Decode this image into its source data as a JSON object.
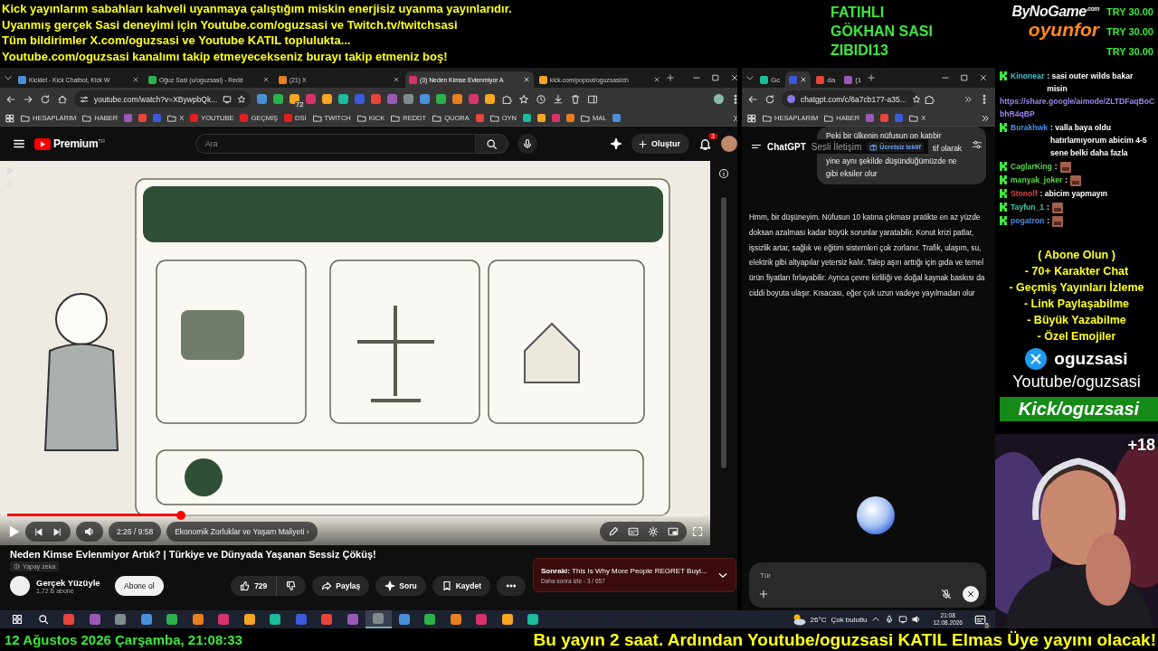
{
  "overlay": {
    "notices": [
      "Kick yayınlarım sabahları kahveli uyanmaya çalıştığım miskin enerjisiz uyanma yayınlarıdır.",
      "Uyanmış gerçek Sasi deneyimi için Youtube.com/oguzsasi ve Twitch.tv/twitchsasi",
      "Tüm bildirimler X.com/oguzsasi ve Youtube KATIL toplulukta...",
      "Youtube.com/oguzsasi kanalımı takip etmeyecekseniz burayı takip etmeniz boş!"
    ],
    "sponsors": [
      "FATIHLI",
      "GÖKHAN SASI",
      "ZIBIDI13"
    ],
    "logo": {
      "name": "ByNoGame",
      "suffix": ".com",
      "sub": "oyunfor"
    },
    "donations": [
      "TRY 30.00",
      "TRY 30.00",
      "TRY 30.00"
    ]
  },
  "left_browser": {
    "tabs": [
      {
        "title": "Kicklet - Kick Chatbot, Kick W",
        "selected": false
      },
      {
        "title": "Oğuz Sasi (u/oguzsasi) - Redd",
        "selected": false
      },
      {
        "title": "(21) X",
        "selected": false
      },
      {
        "title": "(3) Neden Kimse Evlenmiyor A",
        "selected": true
      },
      {
        "title": "kick.com/popout/oguzsasi/ch",
        "selected": false
      }
    ],
    "url": "youtube.com/watch?v=XBywpbQk...",
    "extension_badge": "72",
    "bookmarks": [
      {
        "kind": "folder",
        "label": "HESAPLARIM"
      },
      {
        "kind": "folder",
        "label": "HABER"
      },
      {
        "kind": "site"
      },
      {
        "kind": "site"
      },
      {
        "kind": "site"
      },
      {
        "kind": "folder",
        "label": "X"
      },
      {
        "kind": "video",
        "label": "YOUTUBE"
      },
      {
        "kind": "video",
        "label": "GEÇMİŞ"
      },
      {
        "kind": "video",
        "label": "DSİ"
      },
      {
        "kind": "folder",
        "label": "TWITCH"
      },
      {
        "kind": "folder",
        "label": "KICK"
      },
      {
        "kind": "folder",
        "label": "REDDT"
      },
      {
        "kind": "folder",
        "label": "QUORA"
      },
      {
        "kind": "site"
      },
      {
        "kind": "folder",
        "label": "OYN"
      },
      {
        "kind": "site"
      },
      {
        "kind": "site"
      },
      {
        "kind": "site"
      },
      {
        "kind": "site"
      },
      {
        "kind": "folder",
        "label": "MAL"
      },
      {
        "kind": "site"
      }
    ]
  },
  "youtube": {
    "logo": "Premium",
    "region": "TR",
    "search_placeholder": "Ara",
    "create": "Oluştur",
    "notifications": "3",
    "player": {
      "level": 0.25,
      "time": "2:26 / 9:58",
      "chapter": "Ekonomik Zorluklar ve Yaşam Maliyeti ›"
    },
    "title": "Neden Kimse Evlenmiyor Artık? | Türkiye ve Dünyada Yaşanan Sessiz Çöküş!",
    "ai_badge": "Yapay zeka",
    "channel": "Gerçek Yüzüyle",
    "subscribers": "1,72 B abone",
    "subscribe": "Abone ol",
    "likes": "729",
    "share": "Paylaş",
    "ask": "Soru",
    "save": "Kaydet",
    "up_next": {
      "title": "**Sonraki:** This Is Why More People REGRET Buyi...",
      "meta": "Daha sonra izle - 3 / 657"
    }
  },
  "right_browser": {
    "tabs": [
      {
        "title": "Gc",
        "selected": false
      },
      {
        "selected": true
      },
      {
        "title": "da",
        "selected": false
      },
      {
        "title": "(1",
        "selected": false
      }
    ],
    "url": "chatgpt.com/c/6a7cb177-a35...",
    "bookmarks": [
      {
        "kind": "folder",
        "label": "HESAPLARIM"
      },
      {
        "kind": "folder",
        "label": "HABER"
      },
      {
        "kind": "site"
      },
      {
        "kind": "site"
      },
      {
        "kind": "site"
      },
      {
        "kind": "folder",
        "label": "X"
      }
    ]
  },
  "chatgpt": {
    "brand": "ChatGPT",
    "mode": "Sesli İletişim",
    "offer": "Ücretsiz teklif",
    "user_message": [
      "Peki bir ülkenin nüfusun on katıbir",
      "tif olarak",
      "yine aynı şekilde düşündüğümüzde ne",
      "gibi eksiler olur"
    ],
    "reply": "Hmm, bir düşüneyim. Nüfusun 10 katına çıkması pratikte en az yüzde doksan azalması kadar büyük sorunlar yaratabilir. Konut krizi patlar, işsizlik artar, sağlık ve eğitim sistemleri çok zorlanır. Trafik, ulaşım, su, elektrik gibi altyapılar yetersiz kalır. Talep aşırı arttığı için gıda ve temel ürün fiyatları fırlayabilir. Ayrıca çevre kirliliği ve doğal kaynak baskısı da ciddi boyuta ulaşır. Kısacası, eğer çok uzun vadeye yayılmadan olur",
    "input_placeholder": "Tür"
  },
  "taskbar": {
    "apps": [
      {
        "selected": false
      },
      {
        "selected": false
      },
      {
        "selected": false
      },
      {
        "selected": false
      },
      {
        "selected": false
      },
      {
        "selected": false
      },
      {
        "selected": false
      },
      {
        "selected": false
      },
      {
        "selected": false
      },
      {
        "selected": false
      },
      {
        "selected": false
      },
      {
        "selected": false
      },
      {
        "selected": true
      },
      {
        "selected": false
      },
      {
        "selected": false
      },
      {
        "selected": false
      },
      {
        "selected": false
      },
      {
        "selected": false
      },
      {
        "selected": false
      }
    ],
    "weather": {
      "temp": "26°C",
      "desc": "Çok bulutlu"
    },
    "time": "21:08",
    "date": "12.08.2026",
    "notifications": "5"
  },
  "side_chat": {
    "messages": [
      {
        "user": "Kinonear",
        "color": "#3ec8d8",
        "message": ": sasi outer wilds bakar misin",
        "link": "https://share.google/aimode/ZLTDFaqBoCbhR4qBP",
        "emote": false
      },
      {
        "user": "Burakhwk",
        "color": "#4a8ee8",
        "message": ": valla baya oldu hatırlamıyorum abicim 4-5 sene belki daha fazla",
        "emote": false
      },
      {
        "user": "CaglarKing",
        "color": "#5ad84a",
        "message": ":",
        "emote": true
      },
      {
        "user": "manyak_joker",
        "color": "#5ad84a",
        "message": ":",
        "emote": true
      },
      {
        "user": "Stonolf",
        "color": "#e04040",
        "message": ": abicim yapmayın",
        "emote": false
      },
      {
        "user": "Tayfun_1",
        "color": "#3ec8a8",
        "message": ":",
        "emote": true
      },
      {
        "user": "pogatron",
        "color": "#4a8ee8",
        "message": ":",
        "emote": true
      }
    ]
  },
  "promo": {
    "heading": "( Abone Olun )",
    "perks": [
      "- 70+ Karakter Chat",
      "- Geçmiş Yayınları İzleme",
      "- Link Paylaşabilme",
      "- Büyük Yazabilme",
      "- Özel Emojiler"
    ],
    "x_handle": "oguzsasi",
    "youtube": "Youtube/oguzsasi",
    "kick": "Kick/oguzsasi"
  },
  "webcam": {
    "label": "+18"
  },
  "footer": {
    "datetime": "12 Ağustos 2026 Çarşamba, 21:08:33",
    "ticker": "Bu yayın 2 saat. Ardından Youtube/oguzsasi KATIL Elmas Üye yayını olacak!"
  }
}
